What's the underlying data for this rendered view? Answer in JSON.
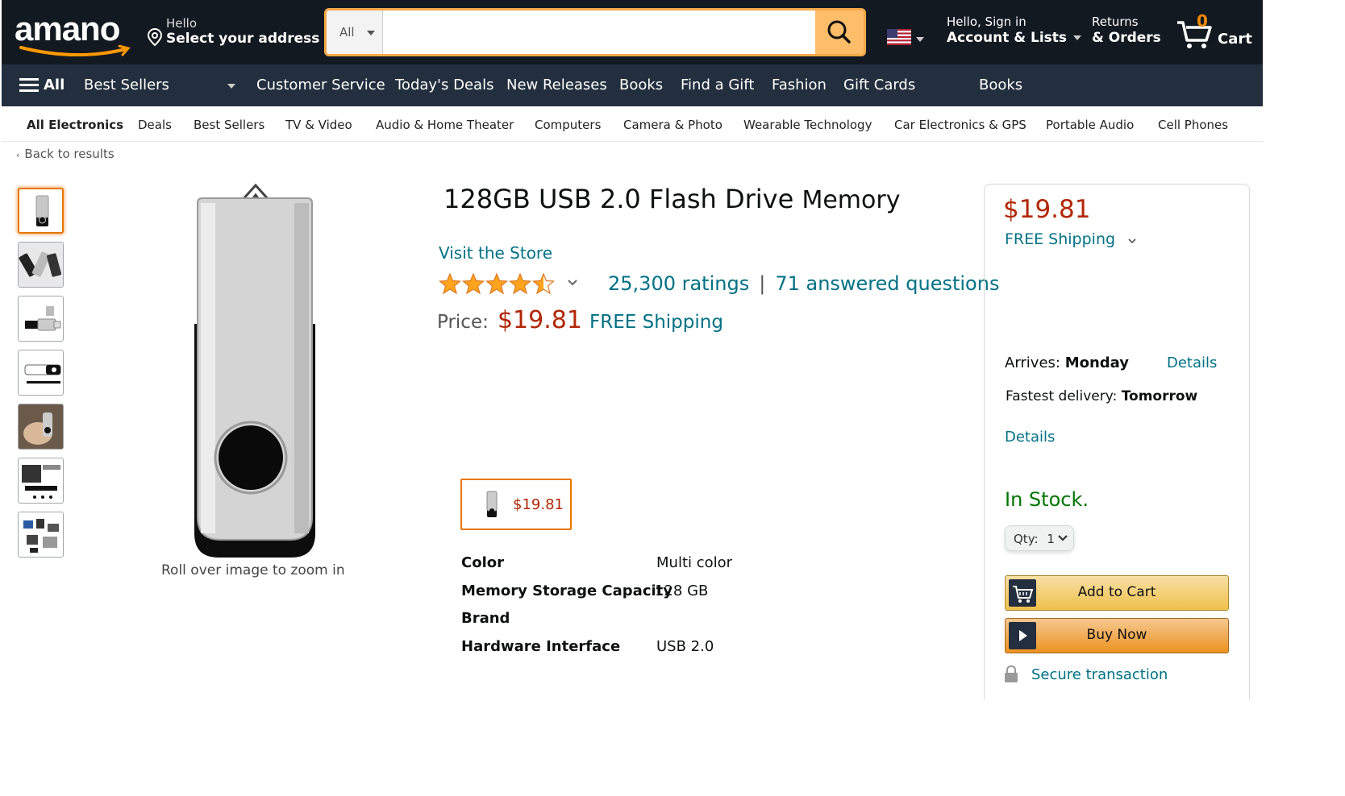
{
  "header": {
    "logo": "amano",
    "address_greeting": "Hello",
    "address_prompt": "Select your address",
    "search_dept": "All",
    "search_placeholder": "",
    "account_greeting": "Hello, Sign in",
    "account_label": "Account & Lists",
    "returns_l1": "Returns",
    "returns_l2": "& Orders",
    "cart_count": "0",
    "cart_label": "Cart"
  },
  "nav": {
    "all": "All",
    "items": [
      "Best Sellers",
      "Customer Service",
      "Today's Deals",
      "New Releases",
      "Books",
      "Find a Gift",
      "Fashion",
      "Gift Cards",
      "Books"
    ]
  },
  "subnav": {
    "items": [
      "All Electronics",
      "Deals",
      "Best Sellers",
      "TV & Video",
      "Audio & Home Theater",
      "Computers",
      "Camera & Photo",
      "Wearable Technology",
      "Car Electronics & GPS",
      "Portable Audio",
      "Cell Phones"
    ]
  },
  "back_link": "Back to results",
  "gallery": {
    "zoom_hint": "Roll over image to zoom in",
    "thumbnail_count": 7
  },
  "product": {
    "title_main": "128GB USB 2.0 Flash Drive",
    "title_tail": "Memory",
    "store_link": "Visit the Store",
    "rating_stars": 4.5,
    "ratings_count": "25,300 ratings",
    "separator": "|",
    "answered": "71 answered questions",
    "price_label": "Price:",
    "price": "$19.81",
    "shipping": "FREE Shipping",
    "option_price": "$19.81",
    "specs": [
      {
        "key": "Color",
        "value": "Multi color"
      },
      {
        "key": "Memory Storage Capacity",
        "value": "128 GB"
      },
      {
        "key": "Brand",
        "value": ""
      },
      {
        "key": "Hardware Interface",
        "value": "USB 2.0"
      }
    ]
  },
  "buybox": {
    "price": "$19.81",
    "shipping": "FREE Shipping",
    "arrives_label": "Arrives: ",
    "arrives_day": "Monday",
    "details1": "Details",
    "fastest_label": "Fastest delivery: ",
    "fastest_day": "Tomorrow",
    "details2": "Details",
    "stock": "In Stock.",
    "qty_label": "Qty:",
    "qty_value": "1",
    "add_to_cart": "Add to Cart",
    "buy_now": "Buy Now",
    "secure": "Secure transaction"
  },
  "colors": {
    "header_bg": "#131921",
    "nav_bg": "#232f3e",
    "link": "#007185",
    "price": "#b12704",
    "stock": "#007600",
    "star": "#ffa41c"
  }
}
